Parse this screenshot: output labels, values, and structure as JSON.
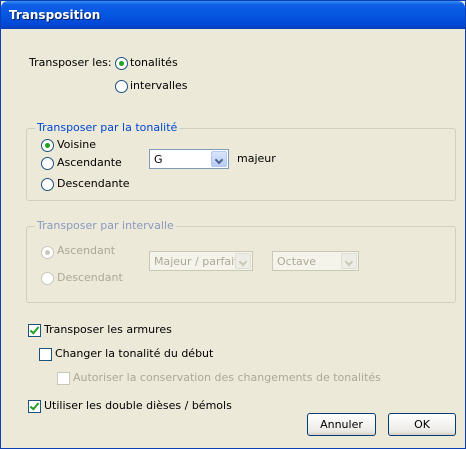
{
  "window": {
    "title": "Transposition"
  },
  "transposer_les": {
    "label": "Transposer les:",
    "options": [
      {
        "label": "tonalités",
        "selected": true
      },
      {
        "label": "intervalles",
        "selected": false
      }
    ]
  },
  "group_tonalite": {
    "title": "Transposer par la tonalité",
    "options": [
      {
        "label": "Voisine",
        "selected": true
      },
      {
        "label": "Ascendante",
        "selected": false
      },
      {
        "label": "Descendante",
        "selected": false
      }
    ],
    "key_select": "G",
    "mode_label": "majeur"
  },
  "group_intervalle": {
    "title": "Transposer par intervalle",
    "enabled": false,
    "options": [
      {
        "label": "Ascendant",
        "selected": true
      },
      {
        "label": "Descendant",
        "selected": false
      }
    ],
    "quality_select": "Majeur / parfait",
    "interval_select": "Octave"
  },
  "options": {
    "transposer_armures": {
      "label": "Transposer les armures",
      "checked": true
    },
    "changer_tonalite": {
      "label": "Changer la tonalité du début",
      "checked": false
    },
    "autoriser_conservation": {
      "label": "Autoriser la conservation des changements de tonalités",
      "checked": false,
      "enabled": false
    },
    "double_dieses": {
      "label": "Utiliser les double dièses / bémols",
      "checked": true
    }
  },
  "buttons": {
    "cancel": "Annuler",
    "ok": "OK"
  },
  "colors": {
    "titlebar": "#0556e0",
    "dialog_bg": "#ece9d8",
    "group_title": "#0046d5",
    "check_mark": "#21a121"
  }
}
